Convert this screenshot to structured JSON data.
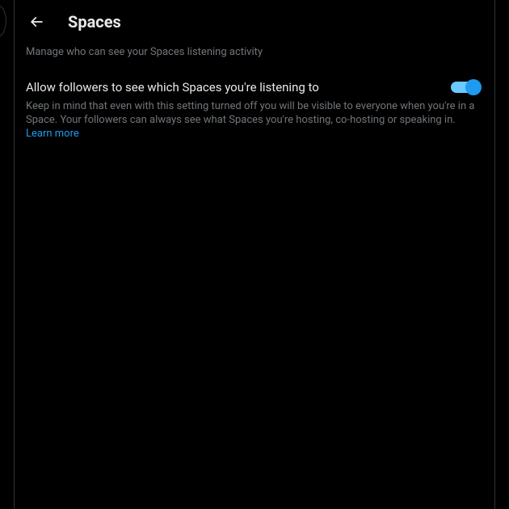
{
  "header": {
    "title": "Spaces"
  },
  "subtitle": "Manage who can see your Spaces listening activity",
  "setting": {
    "label": "Allow followers to see which Spaces you're listening to",
    "description": "Keep in mind that even with this setting turned off you will be visible to everyone when you're in a Space. Your followers can always see what Spaces you're hosting, co-hosting or speaking in. ",
    "learn_more": "Learn more",
    "toggle_on": true
  }
}
